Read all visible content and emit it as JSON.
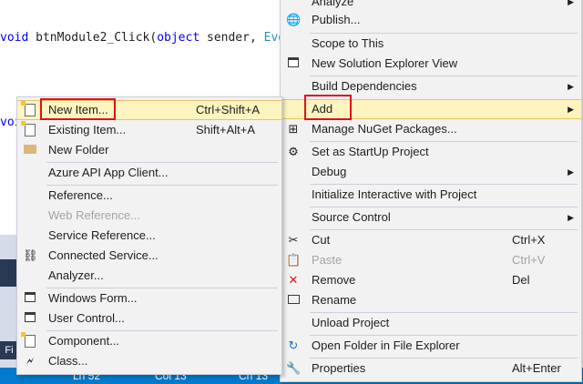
{
  "editor": {
    "line1": {
      "kw": "void",
      "mid": " btnModule2_Click(",
      "kw2": "object",
      "rest": " sender, ",
      "ty": "EventArgs"
    },
    "line2": {
      "kw": "void"
    },
    "side_button": "Fi"
  },
  "status_bar": {
    "ln": "Ln 52",
    "col": "Col 13",
    "ch": "Ch 13"
  },
  "main_menu": {
    "items": [
      {
        "label": "Analyze",
        "arrow": "▶"
      },
      {
        "label": "Publish...",
        "icon": "globe-icon"
      },
      {
        "label": "Scope to This"
      },
      {
        "label": "New Solution Explorer View",
        "icon": "new-view-icon"
      },
      {
        "label": "Build Dependencies",
        "arrow": "▶"
      },
      {
        "label": "Add",
        "arrow": "▶"
      },
      {
        "label": "Manage NuGet Packages...",
        "icon": "nuget-icon"
      },
      {
        "label": "Set as StartUp Project",
        "icon": "gear-icon"
      },
      {
        "label": "Debug",
        "arrow": "▶"
      },
      {
        "label": "Initialize Interactive with Project"
      },
      {
        "label": "Source Control",
        "arrow": "▶"
      },
      {
        "label": "Cut",
        "shortcut": "Ctrl+X",
        "icon": "scissors-icon"
      },
      {
        "label": "Paste",
        "shortcut": "Ctrl+V",
        "icon": "paste-icon"
      },
      {
        "label": "Remove",
        "shortcut": "Del",
        "icon": "remove-icon"
      },
      {
        "label": "Rename",
        "icon": "rename-icon"
      },
      {
        "label": "Unload Project"
      },
      {
        "label": "Open Folder in File Explorer",
        "icon": "refresh-arrow-icon"
      },
      {
        "label": "Properties",
        "shortcut": "Alt+Enter",
        "icon": "wrench-icon"
      }
    ]
  },
  "sub_menu": {
    "items": [
      {
        "label": "New Item...",
        "shortcut": "Ctrl+Shift+A",
        "icon": "new-item-icon"
      },
      {
        "label": "Existing Item...",
        "shortcut": "Shift+Alt+A",
        "icon": "existing-item-icon"
      },
      {
        "label": "New Folder",
        "icon": "folder-icon"
      },
      {
        "label": "Azure API App Client..."
      },
      {
        "label": "Reference..."
      },
      {
        "label": "Web Reference..."
      },
      {
        "label": "Service Reference..."
      },
      {
        "label": "Connected Service...",
        "icon": "connected-service-icon"
      },
      {
        "label": "Analyzer..."
      },
      {
        "label": "Windows Form...",
        "icon": "windows-form-icon"
      },
      {
        "label": "User Control...",
        "icon": "user-control-icon"
      },
      {
        "label": "Component...",
        "icon": "component-icon"
      },
      {
        "label": "Class...",
        "icon": "class-icon"
      }
    ]
  },
  "colors": {
    "highlight": "#fdf4bf",
    "highlight_border": "#e5c365",
    "annotation": "#e0101a",
    "menu_bg": "#f2f2f2",
    "disabled": "#a2a4a5"
  }
}
